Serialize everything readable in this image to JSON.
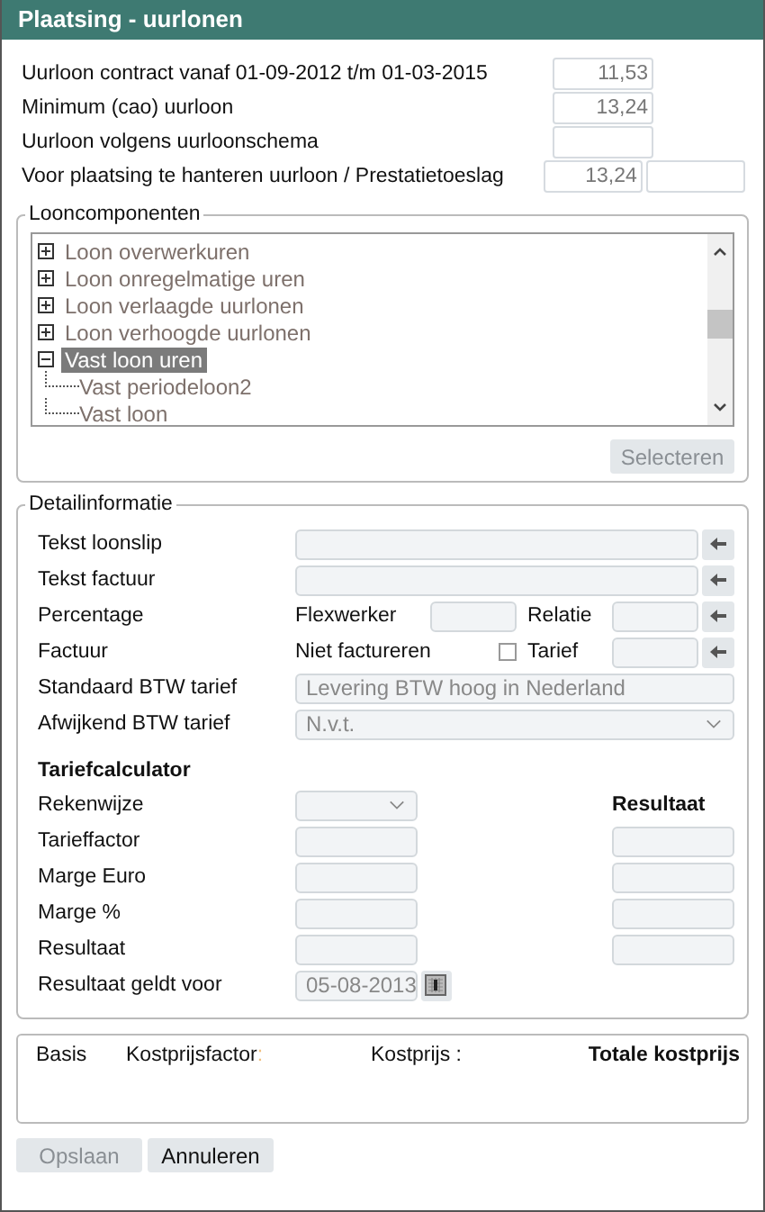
{
  "window": {
    "title": "Plaatsing - uurlonen"
  },
  "wage_rows": [
    {
      "label": "Uurloon contract vanaf 01-09-2012 t/m 01-03-2015",
      "value": "11,53"
    },
    {
      "label": "Minimum (cao) uurloon",
      "value": "13,24"
    },
    {
      "label": "Uurloon volgens uurloonschema"
    },
    {
      "label": "Voor plaatsing te hanteren uurloon / Prestatietoeslag",
      "value": "13,24",
      "extra_field": true
    }
  ],
  "loon_componenten": {
    "legend": "Looncomponenten",
    "tree": [
      {
        "label": "Loon overwerkuren",
        "expanded": false,
        "selected": false
      },
      {
        "label": "Loon onregelmatige uren",
        "expanded": false,
        "selected": false
      },
      {
        "label": "Loon verlaagde uurlonen",
        "expanded": false,
        "selected": false
      },
      {
        "label": "Loon verhoogde uurlonen",
        "expanded": false,
        "selected": false
      },
      {
        "label": "Vast loon uren",
        "expanded": true,
        "selected": true,
        "children": [
          {
            "label": "Vast periodeloon2",
            "selected": false
          },
          {
            "label": "Vast loon",
            "selected": false
          }
        ]
      }
    ],
    "select_button": {
      "label": "Selecteren",
      "disabled": true
    }
  },
  "detail": {
    "legend": "Detailinformatie",
    "tekst_loonslip": {
      "label": "Tekst loonslip"
    },
    "tekst_factuur": {
      "label": "Tekst factuur"
    },
    "percentage": {
      "label": "Percentage",
      "flexwerker": "Flexwerker",
      "relatie": "Relatie"
    },
    "factuur": {
      "label": "Factuur",
      "niet_factureren": "Niet factureren",
      "checked": false,
      "tarief": "Tarief"
    },
    "standaard_btw": {
      "label": "Standaard BTW tarief",
      "value": "Levering BTW hoog in Nederland"
    },
    "afwijkend_btw": {
      "label": "Afwijkend BTW tarief",
      "value": "N.v.t."
    },
    "calculator": {
      "title": "Tariefcalculator",
      "result_header": "Resultaat",
      "rows": [
        {
          "label": "Rekenwijze",
          "kind": "select"
        },
        {
          "label": "Tarieffactor",
          "kind": "pair"
        },
        {
          "label": "Marge Euro",
          "kind": "pair"
        },
        {
          "label": "Marge %",
          "kind": "pair"
        },
        {
          "label": "Resultaat",
          "kind": "pair"
        },
        {
          "label": "Resultaat geldt voor",
          "kind": "date",
          "value": "05-08-2013"
        }
      ]
    }
  },
  "cost_summary": {
    "columns": [
      {
        "label": "Basis"
      },
      {
        "label": "Kostprijsfactor",
        "suffix": ":"
      },
      {
        "label": "Kostprijs :"
      },
      {
        "label": "Totale kostprijs"
      }
    ]
  },
  "buttons": [
    {
      "label": "Opslaan",
      "disabled": true
    },
    {
      "label": "Annuleren",
      "disabled": false
    }
  ]
}
